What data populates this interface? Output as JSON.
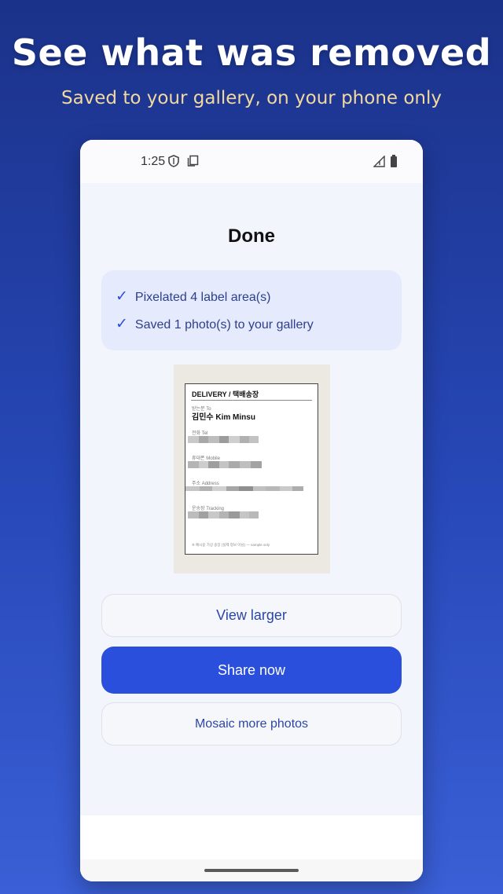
{
  "promo": {
    "headline": "See what was removed",
    "subline": "Saved to your gallery, on your phone only"
  },
  "status_bar": {
    "time": "1:25",
    "icons": [
      "shield-icon",
      "copy-icon",
      "signal-icon",
      "battery-icon"
    ]
  },
  "screen": {
    "title": "Done",
    "summary": [
      {
        "icon": "check-icon",
        "text": "Pixelated 4 label area(s)"
      },
      {
        "icon": "check-icon",
        "text": "Saved 1 photo(s) to your gallery"
      }
    ],
    "preview": {
      "header": "DELIVERY / 택배송장",
      "recipient_label": "받는분 To",
      "recipient_name": "김민수 Kim Minsu",
      "fields": [
        "전화 Tel",
        "휴대폰 Mobile",
        "주소 Address",
        "운송장 Tracking"
      ],
      "footer": "※ 예시용 가상 송장 (실제 정보 아님) — sample only"
    },
    "buttons": {
      "view_larger": "View larger",
      "share_now": "Share now",
      "mosaic_more": "Mosaic more photos"
    }
  },
  "colors": {
    "background_top": "#1b3289",
    "background_bottom": "#3a5fd6",
    "subline": "#f2d9a0",
    "primary": "#2a4fdc",
    "summary_bg": "#e5eafd",
    "accent_text": "#2c46a8"
  }
}
